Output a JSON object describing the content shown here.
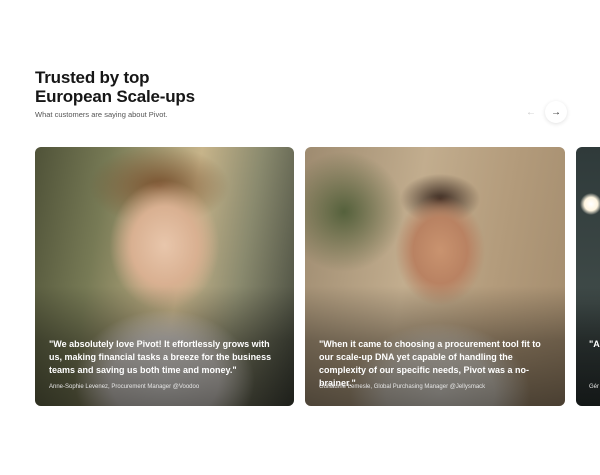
{
  "header": {
    "title_line1": "Trusted by top",
    "title_line2": "European Scale-ups",
    "subtitle": "What customers are saying about Pivot."
  },
  "nav": {
    "prev_icon": "arrow-left-icon",
    "next_icon": "arrow-right-icon",
    "prev_symbol": "←",
    "next_symbol": "→"
  },
  "testimonials": [
    {
      "quote": "\"We absolutely love Pivot! It effortlessly grows with us, making financial tasks a breeze for the business teams and saving us both time and money.\"",
      "author": "Anne-Sophie Levenez, Procurement Manager @Voodoo"
    },
    {
      "quote": "\"When it came to choosing a procurement tool fit to our scale-up DNA yet capable of handling the complexity of our specific needs, Pivot was a no-brainer.\"",
      "author": "Guillaume Lemesle, Global Purchasing Manager @Jellysmack"
    },
    {
      "quote": "\"As spe sto tha",
      "author": "Gér"
    }
  ]
}
